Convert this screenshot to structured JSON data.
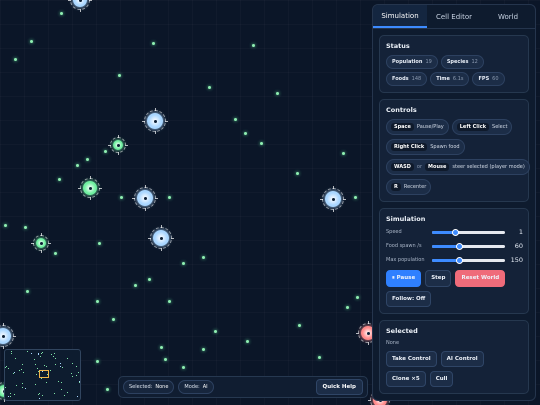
{
  "tabs": [
    {
      "label": "Simulation",
      "active": true
    },
    {
      "label": "Cell Editor",
      "active": false
    },
    {
      "label": "World",
      "active": false
    }
  ],
  "status": {
    "title": "Status",
    "population": {
      "label": "Population",
      "value": "19"
    },
    "species": {
      "label": "Species",
      "value": "12"
    },
    "foods": {
      "label": "Foods",
      "value": "148"
    },
    "time": {
      "label": "Time",
      "value": "6.1s"
    },
    "fps": {
      "label": "FPS",
      "value": "60"
    }
  },
  "controls": {
    "title": "Controls",
    "space": {
      "key": "Space",
      "action": "Pause/Play"
    },
    "left_click": {
      "key": "Left Click",
      "action": "Select"
    },
    "right_click": {
      "key": "Right Click",
      "action": "Spawn food"
    },
    "wasd": {
      "key": "WASD",
      "or": "or",
      "key2": "Mouse",
      "action": "steer selected (player mode)"
    },
    "recenter": {
      "key": "R",
      "action": "Recenter"
    }
  },
  "simulation": {
    "title": "Simulation",
    "speed": {
      "label": "Speed",
      "value": "1",
      "fraction": 0.32
    },
    "food_spawn": {
      "label": "Food spawn /s",
      "value": "60",
      "fraction": 0.38
    },
    "max_population": {
      "label": "Max population",
      "value": "150",
      "fraction": 0.38
    },
    "pause_label": "⏸ Pause",
    "step_label": "Step",
    "reset_label": "Reset World",
    "follow_label": "Follow: Off"
  },
  "selected": {
    "title": "Selected",
    "value": "None",
    "take_control": "Take Control",
    "ai_control": "AI Control",
    "clone": "Clone ×5",
    "cull": "Cull"
  },
  "bottombar": {
    "selected_label": "Selected:",
    "selected_value": "None",
    "mode_label": "Mode:",
    "mode_value": "AI",
    "quick_help": "Quick Help"
  },
  "colors": {
    "accent": "#3d8bff",
    "danger": "#ef6b7a",
    "food": "#8ff0b2",
    "cell_blue": "#a9d6ff",
    "cell_green": "#6ff0a0",
    "cell_red": "#ff8a8a"
  }
}
